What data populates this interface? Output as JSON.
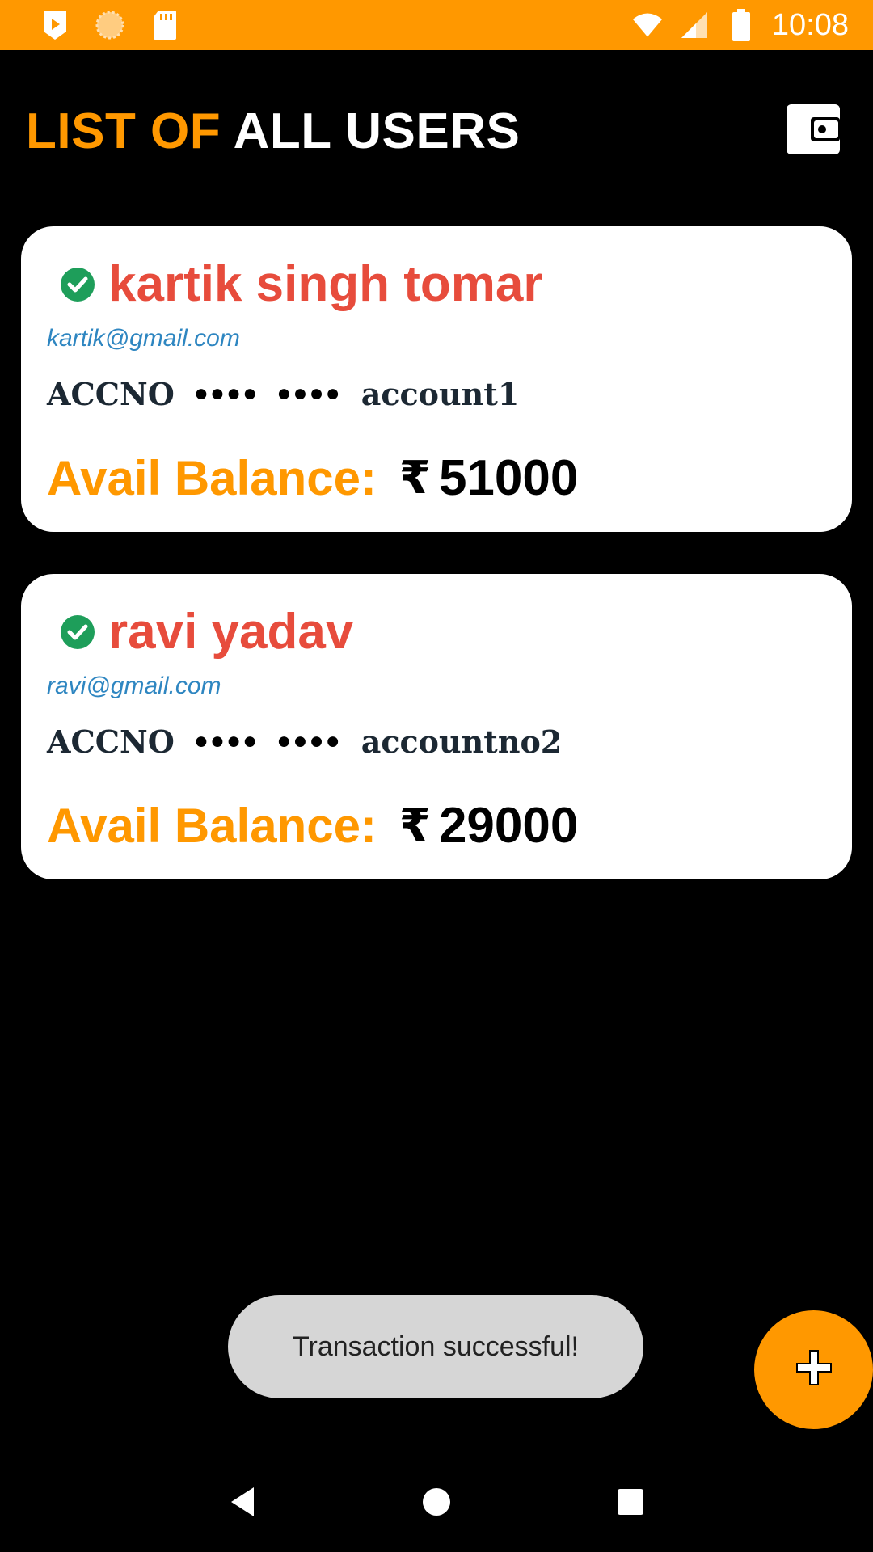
{
  "status_bar": {
    "time": "10:08",
    "icons": [
      "play-store-icon",
      "sun-icon",
      "sd-card-icon",
      "wifi-icon",
      "signal-icon",
      "battery-icon"
    ]
  },
  "header": {
    "title_accent": "LIST OF",
    "title_main": "ALL USERS",
    "wallet_icon": "wallet-icon"
  },
  "users": [
    {
      "name": "kartik singh tomar",
      "email": "kartik@gmail.com",
      "acc_label": "ACCNO",
      "mask1": "●●●●",
      "mask2": "●●●●",
      "account": "account1",
      "balance_label": "Avail Balance:",
      "currency": "₹",
      "balance": "51000"
    },
    {
      "name": "ravi yadav",
      "email": "ravi@gmail.com",
      "acc_label": "ACCNO",
      "mask1": "●●●●",
      "mask2": "●●●●",
      "account": "accountno2",
      "balance_label": "Avail Balance:",
      "currency": "₹",
      "balance": "29000"
    }
  ],
  "toast": {
    "message": "Transaction successful!"
  },
  "fab": {
    "icon": "plus-icon"
  },
  "nav_bar": {
    "icons": [
      "back-icon",
      "home-icon",
      "recents-icon"
    ]
  },
  "colors": {
    "accent": "#FF9800",
    "name": "#E74C3C",
    "email": "#2E86C1",
    "verified": "#1E9E5A",
    "background": "#000000",
    "card": "#FFFFFF"
  }
}
